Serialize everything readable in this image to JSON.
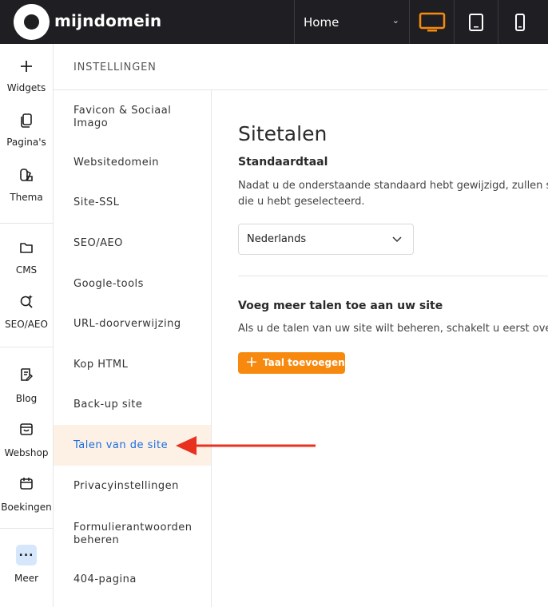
{
  "topbar": {
    "logo_text": "mijndomein",
    "page_select": "Home",
    "devices": [
      "desktop-icon",
      "tablet-icon",
      "mobile-icon"
    ],
    "active_device_color": "#f7890f"
  },
  "rail": {
    "widgets": "Widgets",
    "paginas": "Pagina's",
    "thema": "Thema",
    "cms": "CMS",
    "seo": "SEO/AEO",
    "blog": "Blog",
    "webshop": "Webshop",
    "boekingen": "Boekingen",
    "meer": "Meer"
  },
  "header": {
    "title": "INSTELLINGEN"
  },
  "menu": {
    "items": [
      "Favicon & Sociaal Imago",
      "Websitedomein",
      "Site-SSL",
      "SEO/AEO",
      "Google-tools",
      "URL-doorverwijzing",
      "Kop HTML",
      "Back-up site",
      "Talen van de site",
      "Privacyinstellingen",
      "Formulierantwoorden beheren",
      "404-pagina"
    ],
    "active_item": "Talen van de site"
  },
  "content": {
    "title": "Sitetalen",
    "default_heading": "Standaardtaal",
    "default_text_1": "Nadat u de onderstaande standaard hebt gewijzigd, zullen si",
    "default_text_2": "die u hebt geselecteerd.",
    "language_value": "Nederlands",
    "more_heading": "Voeg meer talen toe aan uw site",
    "more_text": "Als u de talen van uw site wilt beheren, schakelt u eerst over n",
    "add_button": "Taal toevoegen"
  },
  "colors": {
    "accent": "#f7890f",
    "active_link": "#1a6fe0",
    "annotation_arrow": "#e8321f"
  }
}
